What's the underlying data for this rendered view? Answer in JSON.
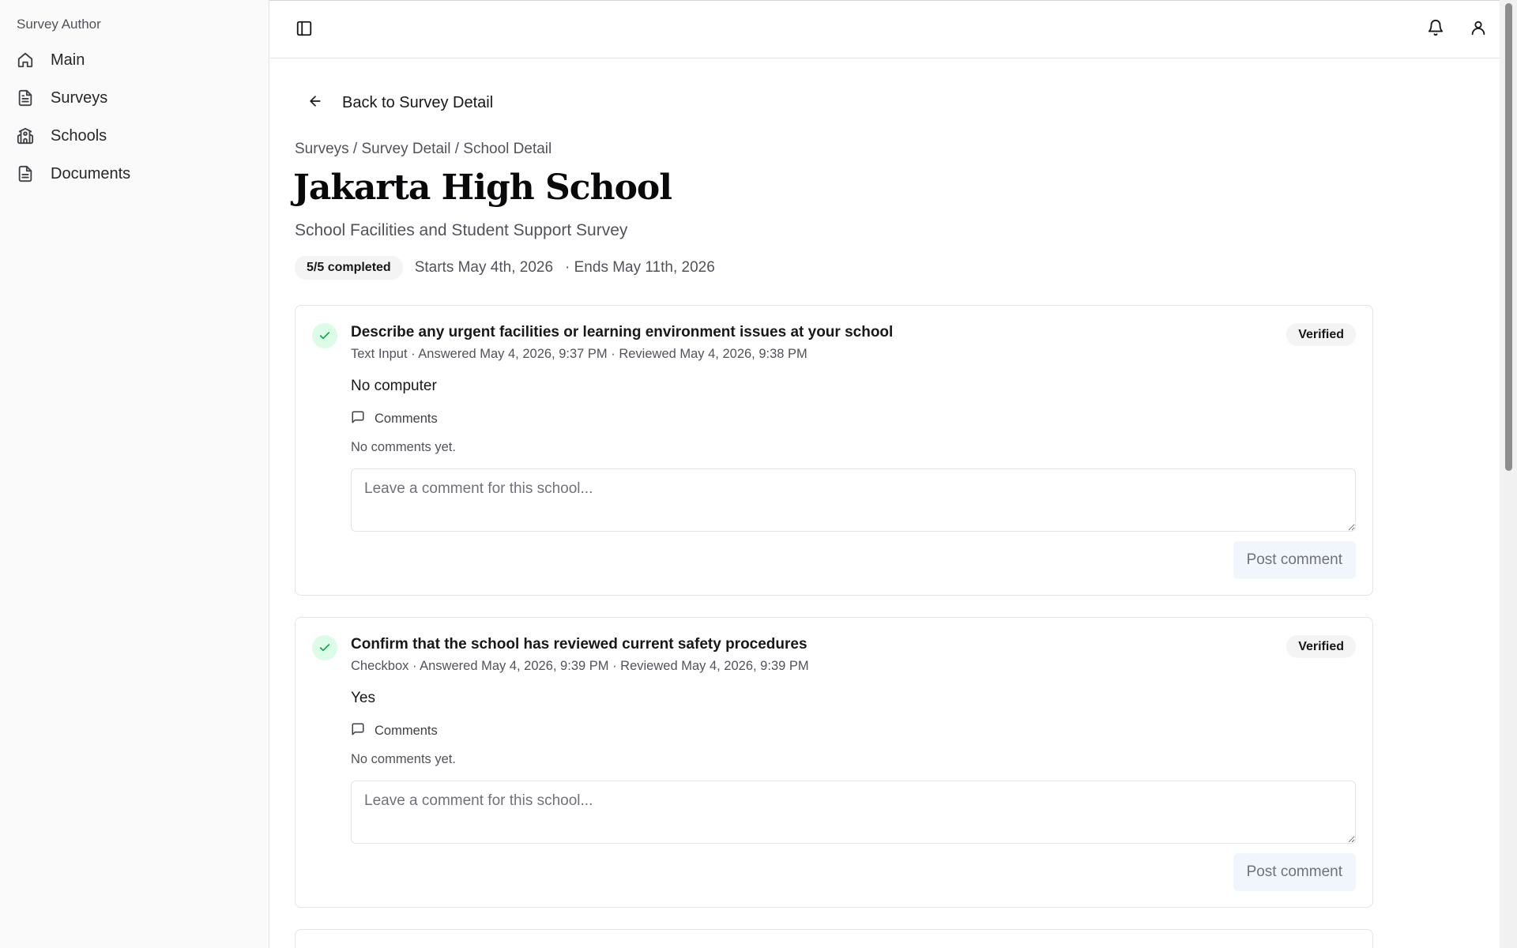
{
  "sidebar": {
    "title": "Survey Author",
    "items": [
      {
        "label": "Main",
        "icon": "home-icon"
      },
      {
        "label": "Surveys",
        "icon": "file-text-icon"
      },
      {
        "label": "Schools",
        "icon": "school-icon"
      },
      {
        "label": "Documents",
        "icon": "document-icon"
      }
    ]
  },
  "header": {
    "toggle_icon": "sidebar-toggle-icon",
    "bell_icon": "bell-icon",
    "user_icon": "user-icon"
  },
  "page": {
    "back_label": "Back to Survey Detail",
    "breadcrumb": "Surveys / Survey Detail / School Detail",
    "title": "Jakarta High School",
    "subtitle": "School Facilities and Student Support Survey",
    "completed": "5/5 completed",
    "starts": "Starts May 4th, 2026",
    "ends": "· Ends May 11th, 2026"
  },
  "questions": [
    {
      "title": "Describe any urgent facilities or learning environment issues at your school",
      "meta": "Text Input · Answered May 4, 2026, 9:37 PM · Reviewed May 4, 2026, 9:38 PM",
      "status": "Verified",
      "answer": "No computer",
      "comments_label": "Comments",
      "no_comments": "No comments yet.",
      "comment_placeholder": "Leave a comment for this school...",
      "post_label": "Post comment"
    },
    {
      "title": "Confirm that the school has reviewed current safety procedures",
      "meta": "Checkbox · Answered May 4, 2026, 9:39 PM · Reviewed May 4, 2026, 9:39 PM",
      "status": "Verified",
      "answer": "Yes",
      "comments_label": "Comments",
      "no_comments": "No comments yet.",
      "comment_placeholder": "Leave a comment for this school...",
      "post_label": "Post comment"
    }
  ],
  "colors": {
    "accent_check_bg": "#dcfce7",
    "accent_check": "#16a34a",
    "post_button_bg": "#f0f6fc"
  }
}
